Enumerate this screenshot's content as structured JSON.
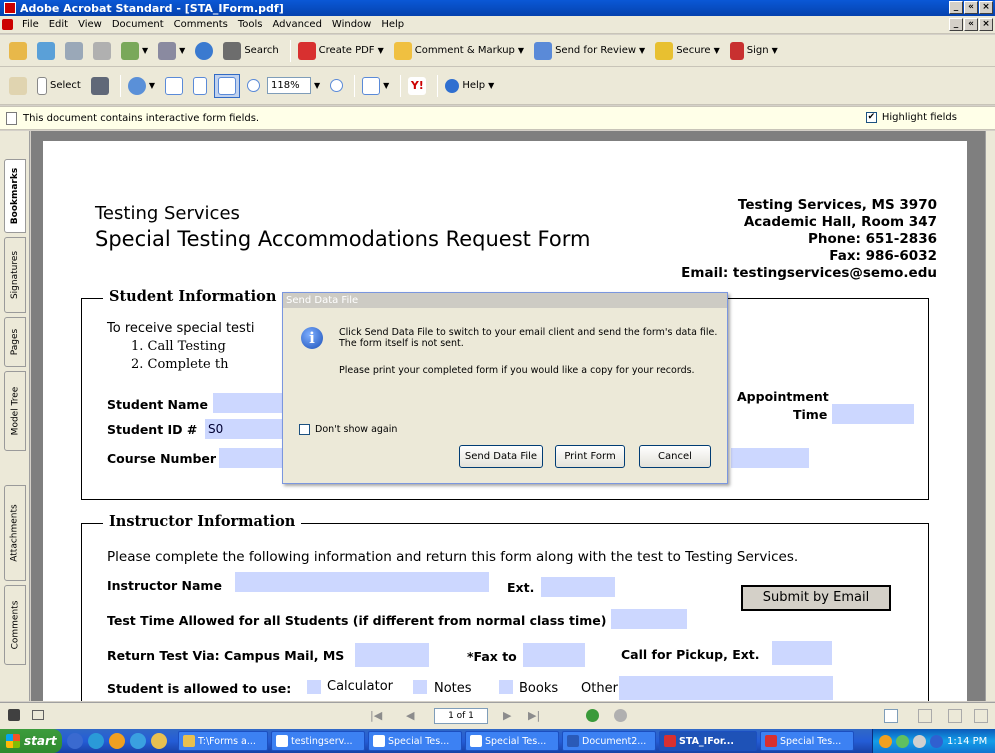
{
  "window": {
    "title": "Adobe Acrobat Standard - [STA_IForm.pdf]",
    "minimize": "_",
    "restore": "«",
    "close": "×"
  },
  "menu": [
    "File",
    "Edit",
    "View",
    "Document",
    "Comments",
    "Tools",
    "Advanced",
    "Window",
    "Help"
  ],
  "toolbar1": {
    "search": "Search",
    "create_pdf": "Create PDF",
    "comment_markup": "Comment & Markup",
    "send_review": "Send for Review",
    "secure": "Secure",
    "sign": "Sign"
  },
  "toolbar2": {
    "select": "Select",
    "zoom": "118%",
    "help": "Help"
  },
  "infobar": {
    "message": "This document contains interactive form fields.",
    "highlight": "Highlight fields",
    "check": "✔"
  },
  "navtabs": [
    "Bookmarks",
    "Signatures",
    "Pages",
    "Model Tree",
    "Attachments",
    "Comments"
  ],
  "form": {
    "title1": "Testing Services",
    "title2": "Special Testing Accommodations Request Form",
    "address": [
      "Testing Services, MS 3970",
      "Academic Hall, Room 347",
      "Phone:  651-2836",
      "Fax:  986-6032",
      "Email: testingservices@semo.edu"
    ],
    "student": {
      "legend": "Student Information",
      "intro": "To receive special testi",
      "step1": "1.  Call  Testing",
      "step2": "2.  Complete th",
      "name_label": "Student Name",
      "id_label": "Student ID #",
      "id_value": "S0",
      "course_label": "Course Number",
      "appt_label1": "Appointment",
      "appt_label2": "Time"
    },
    "instructor": {
      "legend": "Instructor Information",
      "instructions": "Please complete the following information and return this form along with the test to Testing Services.",
      "name_label": "Instructor Name",
      "ext_label": "Ext.",
      "submit": "Submit by Email",
      "time_label": "Test Time Allowed for all Students (if different from normal class time)",
      "return_label": "Return Test Via:  Campus Mail, MS",
      "fax_label": "*Fax to",
      "pickup_label": "Call for Pickup, Ext.",
      "allowed_label": "Student is allowed to use:",
      "calc": "Calculator",
      "notes": "Notes",
      "books": "Books",
      "other": "Other"
    }
  },
  "dialog": {
    "title": "Send Data File",
    "info": "i",
    "message1": "Click Send Data File to switch to your email client and send the form's data file. The form itself is not sent.",
    "message2": "Please print your completed form if you would like a copy for your records.",
    "dont_show": "Don't show again",
    "send": "Send Data File",
    "print": "Print Form",
    "cancel": "Cancel"
  },
  "status": {
    "page": "1 of 1"
  },
  "taskbar": {
    "start": "start",
    "items": [
      "T:\\Forms a...",
      "testingserv...",
      "Special Tes...",
      "Special Tes...",
      "Document2...",
      "STA_IFor...",
      "Special Tes..."
    ],
    "clock": "1:14 PM"
  }
}
